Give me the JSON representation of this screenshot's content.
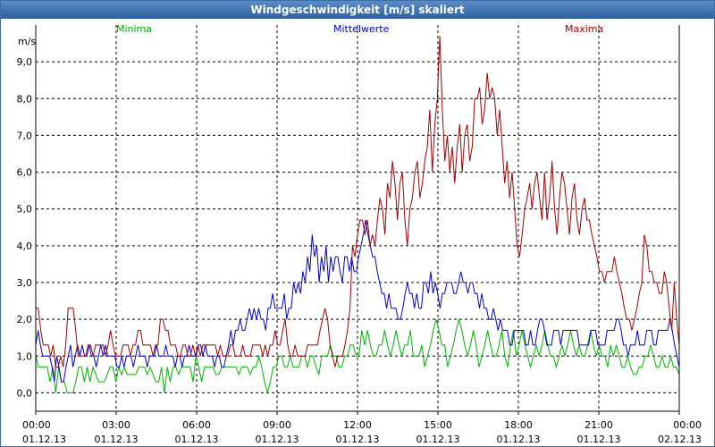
{
  "window": {
    "title": "Windgeschwindigkeit [m/s] skaliert"
  },
  "colors": {
    "minima": "#00b000",
    "mittelwerte": "#0000cc",
    "maxima": "#a00000",
    "titlebar": "#3b6ea5"
  },
  "chart_data": {
    "type": "line",
    "title": "Windgeschwindigkeit [m/s] skaliert",
    "ylabel": "m/s",
    "xlabel": "",
    "ylim": [
      -0.5,
      10.0
    ],
    "yticks": [
      "0,0",
      "1,0",
      "2,0",
      "3,0",
      "4,0",
      "5,0",
      "6,0",
      "7,0",
      "8,0",
      "9,0"
    ],
    "xlim_hours": [
      0,
      24
    ],
    "xticks": [
      {
        "time": "00:00",
        "date": "01.12.13"
      },
      {
        "time": "03:00",
        "date": "01.12.13"
      },
      {
        "time": "06:00",
        "date": "01.12.13"
      },
      {
        "time": "09:00",
        "date": "01.12.13"
      },
      {
        "time": "12:00",
        "date": "01.12.13"
      },
      {
        "time": "15:00",
        "date": "01.12.13"
      },
      {
        "time": "18:00",
        "date": "01.12.13"
      },
      {
        "time": "21:00",
        "date": "01.12.13"
      },
      {
        "time": "00:00",
        "date": "02.12.13"
      }
    ],
    "grid": true,
    "legend_placement": "top",
    "series": [
      {
        "name": "Minima",
        "color": "#00b000",
        "values": [
          1.0,
          0.7,
          0.7,
          0.7,
          0.7,
          0.3,
          0.7,
          0.0,
          0.7,
          0.3,
          0.3,
          0.0,
          0.0,
          0.0,
          0.3,
          0.7,
          0.7,
          0.3,
          0.7,
          0.3,
          0.7,
          0.5,
          0.3,
          0.3,
          0.3,
          0.5,
          0.7,
          0.7,
          0.3,
          0.7,
          0.5,
          0.7,
          0.5,
          0.5,
          0.5,
          0.5,
          0.7,
          0.7,
          0.7,
          0.5,
          0.7,
          0.5,
          0.3,
          0.3,
          0.7,
          0.0,
          0.7,
          0.3,
          0.7,
          0.7,
          0.5,
          0.7,
          0.7,
          0.7,
          0.7,
          0.3,
          1.0,
          0.7,
          0.3,
          0.7,
          0.7,
          0.7,
          0.7,
          0.5,
          0.5,
          0.7,
          0.7,
          0.7,
          0.7,
          0.7,
          0.7,
          0.5,
          0.7,
          0.7,
          0.7,
          0.5,
          0.7,
          0.7,
          1.0,
          0.7,
          0.3,
          0.0,
          0.3,
          0.7,
          0.7,
          1.0,
          1.0,
          0.7,
          0.7,
          1.0,
          0.7,
          0.7,
          0.7,
          1.0,
          1.0,
          0.7,
          1.0,
          1.0,
          0.7,
          0.5,
          1.0,
          1.0,
          1.0,
          1.3,
          1.0,
          1.0,
          0.7,
          0.7,
          1.0,
          1.0,
          1.3,
          1.3,
          1.0,
          1.0,
          1.7,
          1.3,
          1.7,
          1.3,
          1.0,
          1.0,
          1.3,
          1.3,
          1.7,
          1.3,
          1.0,
          1.3,
          1.7,
          1.3,
          1.0,
          1.3,
          1.3,
          1.7,
          1.0,
          1.0,
          1.0,
          1.3,
          0.7,
          1.0,
          1.3,
          1.7,
          2.0,
          1.7,
          1.3,
          1.3,
          0.7,
          1.0,
          1.3,
          1.7,
          2.0,
          1.7,
          1.3,
          1.0,
          1.3,
          1.7,
          1.3,
          0.7,
          1.0,
          1.3,
          1.7,
          1.3,
          1.0,
          1.0,
          1.3,
          1.7,
          1.0,
          0.7,
          1.3,
          1.7,
          1.0,
          1.3,
          1.7,
          1.3,
          1.0,
          0.7,
          1.0,
          1.3,
          1.0,
          1.3,
          1.7,
          1.3,
          1.0,
          1.0,
          0.7,
          1.0,
          1.3,
          1.0,
          1.3,
          1.7,
          1.3,
          1.0,
          1.3,
          1.0,
          1.0,
          1.3,
          1.7,
          1.3,
          1.0,
          1.3,
          1.0,
          1.0,
          0.7,
          1.3,
          1.0,
          1.3,
          1.0,
          0.7,
          0.7,
          1.0,
          0.7,
          0.5,
          0.5,
          0.7,
          0.7,
          1.0,
          1.0,
          1.3,
          1.0,
          0.7,
          0.7,
          1.0,
          0.7,
          0.7,
          1.0,
          0.7,
          0.7,
          0.5
        ]
      },
      {
        "name": "Mittelwerte",
        "color": "#0000cc",
        "values": [
          1.3,
          1.7,
          1.3,
          1.0,
          1.0,
          1.0,
          1.0,
          0.7,
          0.3,
          1.0,
          0.7,
          0.3,
          0.3,
          0.7,
          1.0,
          1.3,
          0.7,
          1.0,
          1.3,
          1.0,
          1.3,
          1.0,
          1.0,
          1.3,
          1.0,
          1.0,
          0.7,
          1.0,
          1.3,
          1.0,
          1.3,
          1.0,
          1.0,
          1.0,
          1.0,
          0.7,
          0.7,
          1.0,
          0.7,
          1.0,
          1.0,
          1.0,
          0.7,
          1.0,
          1.3,
          1.0,
          1.0,
          1.0,
          0.7,
          1.0,
          1.0,
          1.0,
          1.3,
          1.0,
          1.0,
          1.0,
          1.3,
          1.0,
          1.0,
          1.0,
          0.7,
          1.0,
          1.0,
          0.7,
          1.0,
          1.0,
          1.3,
          1.0,
          1.0,
          1.0,
          1.3,
          1.3,
          1.0,
          1.3,
          1.0,
          1.0,
          1.0,
          0.7,
          1.0,
          1.0,
          0.7,
          0.7,
          1.0,
          1.3,
          1.7,
          1.3,
          1.7,
          1.7,
          2.0,
          1.7,
          1.7,
          2.0,
          2.3,
          2.0,
          2.3,
          2.0,
          2.3,
          2.0,
          2.0,
          1.7,
          2.3,
          2.3,
          2.7,
          2.3,
          2.3,
          2.3,
          2.3,
          2.7,
          2.0,
          2.3,
          2.3,
          3.0,
          2.7,
          3.0,
          2.7,
          3.3,
          3.0,
          3.7,
          3.3,
          4.3,
          3.7,
          4.0,
          3.0,
          3.7,
          3.3,
          4.0,
          3.0,
          3.7,
          3.3,
          3.7,
          3.7,
          3.3,
          3.0,
          3.7,
          3.7,
          3.3,
          3.7,
          3.3,
          3.3,
          3.7,
          4.0,
          4.3,
          4.7,
          4.3,
          4.0,
          3.7,
          3.7,
          3.3,
          3.0,
          2.7,
          2.7,
          2.3,
          2.7,
          2.3,
          2.3,
          2.3,
          2.0,
          2.0,
          2.3,
          2.7,
          3.0,
          2.7,
          2.7,
          2.3,
          2.7,
          2.3,
          2.3,
          3.0,
          3.0,
          2.7,
          3.3,
          2.7,
          3.0,
          2.7,
          2.3,
          2.7,
          2.7,
          3.0,
          3.0,
          3.0,
          2.7,
          2.7,
          3.0,
          3.3,
          3.0,
          3.0,
          2.7,
          3.0,
          3.0,
          2.7,
          2.7,
          2.3,
          2.7,
          2.3,
          2.3,
          2.0,
          2.0,
          2.3,
          2.0,
          1.7,
          2.0,
          1.7,
          1.7,
          1.7,
          1.3,
          1.3,
          1.7,
          1.7,
          1.7,
          1.7,
          1.7,
          1.3,
          1.3,
          1.7,
          1.3,
          1.3,
          1.7,
          2.0,
          2.0,
          1.7,
          1.3,
          1.3,
          1.3,
          1.7,
          1.7,
          1.7,
          1.3,
          1.7,
          1.7,
          1.7,
          1.7,
          1.7,
          1.7,
          1.7,
          1.3,
          1.3,
          1.3,
          1.3,
          1.3,
          1.7,
          1.7,
          1.7,
          1.3,
          1.3,
          1.3,
          1.3,
          1.7,
          1.7,
          1.7,
          1.7,
          2.0,
          2.0,
          1.7,
          1.3,
          1.3,
          1.0,
          1.3,
          1.3,
          1.3,
          1.7,
          1.3,
          1.3,
          1.3,
          1.7,
          1.7,
          1.7,
          1.3,
          1.3,
          1.7,
          1.7,
          1.7,
          1.7,
          1.7,
          2.0,
          1.7,
          1.3,
          1.0,
          0.7
        ]
      },
      {
        "name": "Maxima",
        "color": "#a00000",
        "values": [
          2.3,
          2.3,
          1.7,
          1.3,
          1.3,
          1.3,
          1.0,
          1.3,
          0.7,
          0.7,
          1.0,
          0.7,
          1.3,
          2.3,
          2.3,
          2.3,
          1.7,
          1.0,
          1.0,
          1.0,
          1.0,
          1.3,
          1.3,
          1.0,
          1.3,
          1.3,
          1.3,
          1.3,
          1.0,
          1.3,
          1.7,
          1.3,
          1.0,
          1.0,
          1.0,
          1.3,
          1.3,
          1.3,
          1.0,
          1.3,
          1.3,
          1.7,
          1.7,
          1.3,
          1.3,
          1.3,
          1.3,
          1.0,
          1.3,
          1.3,
          2.0,
          2.0,
          1.7,
          1.7,
          1.3,
          1.3,
          1.3,
          1.0,
          1.0,
          1.3,
          1.3,
          1.0,
          1.0,
          1.3,
          1.0,
          1.3,
          1.0,
          1.3,
          1.3,
          1.3,
          1.3,
          1.3,
          1.3,
          1.0,
          1.3,
          1.0,
          1.0,
          1.0,
          1.3,
          1.3,
          1.0,
          1.0,
          1.0,
          1.3,
          1.0,
          1.0,
          1.0,
          1.3,
          1.3,
          1.3,
          1.3,
          1.0,
          1.3,
          1.0,
          1.3,
          1.3,
          1.7,
          1.3,
          1.3,
          1.7,
          2.0,
          1.3,
          1.0,
          1.0,
          1.3,
          1.0,
          1.0,
          1.0,
          1.0,
          1.3,
          1.3,
          1.3,
          1.3,
          1.3,
          1.7,
          2.0,
          2.3,
          2.0,
          1.3,
          1.0,
          0.7,
          1.0,
          1.0,
          1.0,
          1.3,
          1.7,
          2.3,
          4.0,
          3.7,
          4.3,
          4.7,
          4.7,
          4.3,
          4.7,
          4.0,
          4.3,
          4.0,
          4.7,
          5.3,
          5.0,
          4.3,
          5.7,
          5.3,
          6.3,
          5.7,
          4.7,
          5.7,
          6.0,
          4.7,
          4.0,
          5.0,
          5.3,
          6.0,
          6.3,
          5.3,
          5.7,
          6.3,
          6.7,
          7.7,
          6.0,
          7.3,
          8.0,
          9.7,
          7.7,
          6.3,
          7.0,
          6.0,
          6.7,
          5.7,
          6.7,
          7.3,
          6.0,
          7.0,
          7.3,
          6.3,
          6.7,
          8.0,
          8.0,
          8.3,
          7.3,
          7.7,
          8.7,
          8.0,
          8.3,
          8.0,
          7.0,
          7.7,
          6.7,
          5.7,
          6.3,
          5.3,
          6.0,
          5.0,
          4.0,
          3.7,
          4.3,
          5.0,
          5.3,
          5.7,
          5.0,
          5.7,
          6.0,
          5.3,
          4.7,
          6.0,
          4.7,
          5.3,
          6.3,
          5.0,
          4.3,
          5.3,
          6.0,
          5.7,
          5.0,
          4.3,
          5.3,
          5.7,
          4.7,
          4.3,
          5.0,
          5.3,
          4.7,
          4.7,
          4.3,
          4.0,
          3.7,
          3.3,
          3.3,
          3.0,
          3.3,
          3.3,
          3.3,
          3.7,
          3.3,
          3.0,
          2.7,
          2.3,
          2.0,
          2.0,
          1.7,
          2.0,
          2.3,
          2.7,
          3.0,
          4.3,
          4.0,
          3.3,
          3.3,
          3.0,
          3.0,
          2.7,
          2.7,
          3.3,
          3.0,
          2.3,
          1.7,
          3.0,
          2.0,
          1.3
        ]
      }
    ]
  },
  "legend": {
    "minima": "Minima",
    "mittelwerte": "Mittelwerte",
    "maxima": "Maxima"
  },
  "axis": {
    "yunit": "m/s"
  }
}
